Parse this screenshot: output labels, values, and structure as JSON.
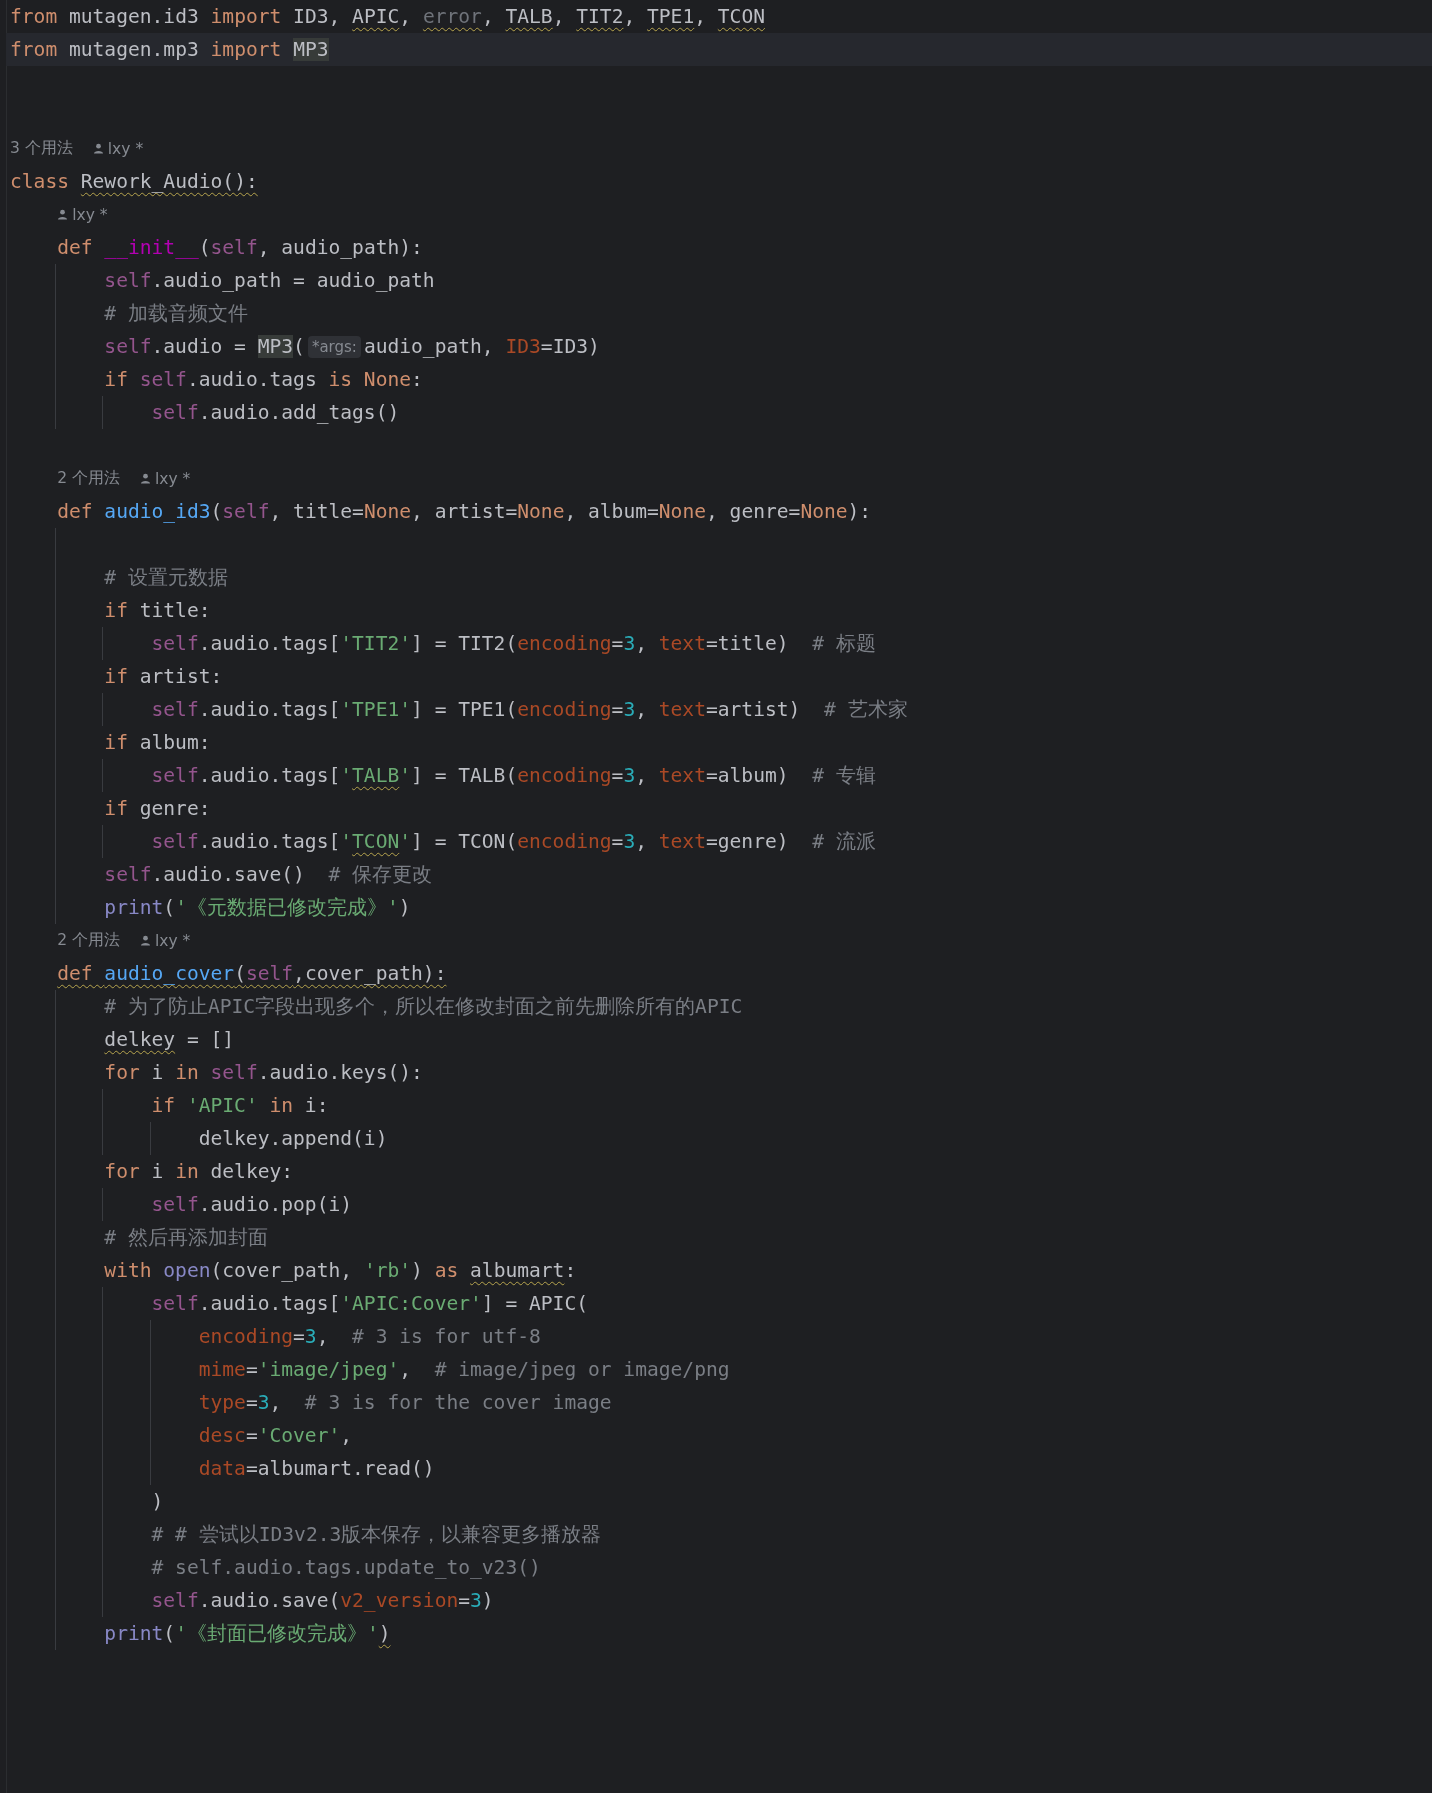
{
  "editor": {
    "lines": [
      {
        "kind": "code",
        "current": false,
        "tokens": [
          {
            "text": "from",
            "kind": "kw"
          },
          {
            "text": " mutagen.id3 ",
            "kind": "plain"
          },
          {
            "text": "import",
            "kind": "kw"
          },
          {
            "text": " ID3, ",
            "kind": "plain"
          },
          {
            "text": "APIC",
            "kind": "plain",
            "squiggle": true
          },
          {
            "text": ", ",
            "kind": "plain"
          },
          {
            "text": "error",
            "kind": "dim",
            "squiggle": true
          },
          {
            "text": ", ",
            "kind": "plain"
          },
          {
            "text": "TALB",
            "kind": "plain",
            "squiggle": true
          },
          {
            "text": ", ",
            "kind": "plain"
          },
          {
            "text": "TIT2",
            "kind": "plain",
            "squiggle": true
          },
          {
            "text": ", ",
            "kind": "plain"
          },
          {
            "text": "TPE1",
            "kind": "plain",
            "squiggle": true
          },
          {
            "text": ", ",
            "kind": "plain"
          },
          {
            "text": "TCON",
            "kind": "plain",
            "squiggle": true
          }
        ]
      },
      {
        "kind": "code",
        "current": true,
        "tokens": [
          {
            "text": "from",
            "kind": "kw"
          },
          {
            "text": " mutagen.mp3 ",
            "kind": "plain"
          },
          {
            "text": "import ",
            "kind": "kw"
          },
          {
            "text": "MP3",
            "kind": "mark"
          }
        ]
      },
      {
        "kind": "blank"
      },
      {
        "kind": "blank"
      },
      {
        "kind": "hint",
        "usages": "3 个用法",
        "author": "lxy *"
      },
      {
        "kind": "code",
        "current": false,
        "tokens": [
          {
            "text": "class ",
            "kind": "kw"
          },
          {
            "text": "Rework_Audio():",
            "kind": "plain",
            "squiggle": true
          }
        ],
        "children": [
          {
            "kind": "hint",
            "author": "lxy *"
          },
          {
            "kind": "code",
            "current": false,
            "tokens": [
              {
                "text": "def ",
                "kind": "kw"
              },
              {
                "text": "__init__",
                "kind": "dunder"
              },
              {
                "text": "(",
                "kind": "plain"
              },
              {
                "text": "self",
                "kind": "self"
              },
              {
                "text": ", audio_path):",
                "kind": "plain"
              }
            ],
            "children": [
              {
                "kind": "code",
                "current": false,
                "tokens": [
                  {
                    "text": "self",
                    "kind": "self"
                  },
                  {
                    "text": ".audio_path = audio_path",
                    "kind": "plain"
                  }
                ]
              },
              {
                "kind": "code",
                "current": false,
                "tokens": [
                  {
                    "text": "# 加载音频文件",
                    "kind": "comment"
                  }
                ]
              },
              {
                "kind": "code",
                "current": false,
                "tokens": [
                  {
                    "text": "self",
                    "kind": "self"
                  },
                  {
                    "text": ".audio = ",
                    "kind": "plain"
                  },
                  {
                    "text": "MP3",
                    "kind": "mark"
                  },
                  {
                    "text": "(",
                    "kind": "plain"
                  },
                  {
                    "text": "*args:",
                    "kind": "inlay"
                  },
                  {
                    "text": "audio_path, ",
                    "kind": "plain"
                  },
                  {
                    "text": "ID3",
                    "kind": "param"
                  },
                  {
                    "text": "=ID3)",
                    "kind": "plain"
                  }
                ]
              },
              {
                "kind": "code",
                "current": false,
                "tokens": [
                  {
                    "text": "if ",
                    "kind": "kw"
                  },
                  {
                    "text": "self",
                    "kind": "self"
                  },
                  {
                    "text": ".audio.tags ",
                    "kind": "plain"
                  },
                  {
                    "text": "is None",
                    "kind": "kw"
                  },
                  {
                    "text": ":",
                    "kind": "plain"
                  }
                ],
                "children": [
                  {
                    "kind": "code",
                    "current": false,
                    "tokens": [
                      {
                        "text": "self",
                        "kind": "self"
                      },
                      {
                        "text": ".audio.add_tags()",
                        "kind": "plain"
                      }
                    ]
                  }
                ]
              }
            ]
          },
          {
            "kind": "blank"
          },
          {
            "kind": "hint",
            "usages": "2 个用法",
            "author": "lxy *"
          },
          {
            "kind": "code",
            "current": false,
            "tokens": [
              {
                "text": "def ",
                "kind": "kw"
              },
              {
                "text": "audio_id3",
                "kind": "func"
              },
              {
                "text": "(",
                "kind": "plain"
              },
              {
                "text": "self",
                "kind": "self"
              },
              {
                "text": ", title=",
                "kind": "plain"
              },
              {
                "text": "None",
                "kind": "kw"
              },
              {
                "text": ", artist=",
                "kind": "plain"
              },
              {
                "text": "None",
                "kind": "kw"
              },
              {
                "text": ", album=",
                "kind": "plain"
              },
              {
                "text": "None",
                "kind": "kw"
              },
              {
                "text": ", genre=",
                "kind": "plain"
              },
              {
                "text": "None",
                "kind": "kw"
              },
              {
                "text": "):",
                "kind": "plain"
              }
            ],
            "children": [
              {
                "kind": "blank"
              },
              {
                "kind": "code",
                "current": false,
                "tokens": [
                  {
                    "text": "# 设置元数据",
                    "kind": "comment"
                  }
                ]
              },
              {
                "kind": "code",
                "current": false,
                "tokens": [
                  {
                    "text": "if",
                    "kind": "kw"
                  },
                  {
                    "text": " title:",
                    "kind": "plain"
                  }
                ],
                "children": [
                  {
                    "kind": "code",
                    "current": false,
                    "tokens": [
                      {
                        "text": "self",
                        "kind": "self"
                      },
                      {
                        "text": ".audio.tags[",
                        "kind": "plain"
                      },
                      {
                        "text": "'TIT2'",
                        "kind": "str"
                      },
                      {
                        "text": "] = TIT2(",
                        "kind": "plain"
                      },
                      {
                        "text": "encoding",
                        "kind": "param"
                      },
                      {
                        "text": "=",
                        "kind": "plain"
                      },
                      {
                        "text": "3",
                        "kind": "num"
                      },
                      {
                        "text": ", ",
                        "kind": "plain"
                      },
                      {
                        "text": "text",
                        "kind": "param"
                      },
                      {
                        "text": "=title)  ",
                        "kind": "plain"
                      },
                      {
                        "text": "# 标题",
                        "kind": "comment"
                      }
                    ]
                  }
                ]
              },
              {
                "kind": "code",
                "current": false,
                "tokens": [
                  {
                    "text": "if",
                    "kind": "kw"
                  },
                  {
                    "text": " artist:",
                    "kind": "plain"
                  }
                ],
                "children": [
                  {
                    "kind": "code",
                    "current": false,
                    "tokens": [
                      {
                        "text": "self",
                        "kind": "self"
                      },
                      {
                        "text": ".audio.tags[",
                        "kind": "plain"
                      },
                      {
                        "text": "'TPE1'",
                        "kind": "str"
                      },
                      {
                        "text": "] = TPE1(",
                        "kind": "plain"
                      },
                      {
                        "text": "encoding",
                        "kind": "param"
                      },
                      {
                        "text": "=",
                        "kind": "plain"
                      },
                      {
                        "text": "3",
                        "kind": "num"
                      },
                      {
                        "text": ", ",
                        "kind": "plain"
                      },
                      {
                        "text": "text",
                        "kind": "param"
                      },
                      {
                        "text": "=artist)  ",
                        "kind": "plain"
                      },
                      {
                        "text": "# 艺术家",
                        "kind": "comment"
                      }
                    ]
                  }
                ]
              },
              {
                "kind": "code",
                "current": false,
                "tokens": [
                  {
                    "text": "if",
                    "kind": "kw"
                  },
                  {
                    "text": " album:",
                    "kind": "plain"
                  }
                ],
                "children": [
                  {
                    "kind": "code",
                    "current": false,
                    "tokens": [
                      {
                        "text": "self",
                        "kind": "self"
                      },
                      {
                        "text": ".audio.tags[",
                        "kind": "plain"
                      },
                      {
                        "text": "'",
                        "kind": "str"
                      },
                      {
                        "text": "TALB",
                        "kind": "str",
                        "squiggle": true
                      },
                      {
                        "text": "'",
                        "kind": "str"
                      },
                      {
                        "text": "] = TALB(",
                        "kind": "plain"
                      },
                      {
                        "text": "encoding",
                        "kind": "param"
                      },
                      {
                        "text": "=",
                        "kind": "plain"
                      },
                      {
                        "text": "3",
                        "kind": "num"
                      },
                      {
                        "text": ", ",
                        "kind": "plain"
                      },
                      {
                        "text": "text",
                        "kind": "param"
                      },
                      {
                        "text": "=album)  ",
                        "kind": "plain"
                      },
                      {
                        "text": "# 专辑",
                        "kind": "comment"
                      }
                    ]
                  }
                ]
              },
              {
                "kind": "code",
                "current": false,
                "tokens": [
                  {
                    "text": "if",
                    "kind": "kw"
                  },
                  {
                    "text": " genre:",
                    "kind": "plain"
                  }
                ],
                "children": [
                  {
                    "kind": "code",
                    "current": false,
                    "tokens": [
                      {
                        "text": "self",
                        "kind": "self"
                      },
                      {
                        "text": ".audio.tags[",
                        "kind": "plain"
                      },
                      {
                        "text": "'",
                        "kind": "str"
                      },
                      {
                        "text": "TCON",
                        "kind": "str",
                        "squiggle": true
                      },
                      {
                        "text": "'",
                        "kind": "str"
                      },
                      {
                        "text": "] = TCON(",
                        "kind": "plain"
                      },
                      {
                        "text": "encoding",
                        "kind": "param"
                      },
                      {
                        "text": "=",
                        "kind": "plain"
                      },
                      {
                        "text": "3",
                        "kind": "num"
                      },
                      {
                        "text": ", ",
                        "kind": "plain"
                      },
                      {
                        "text": "text",
                        "kind": "param"
                      },
                      {
                        "text": "=genre)  ",
                        "kind": "plain"
                      },
                      {
                        "text": "# 流派",
                        "kind": "comment"
                      }
                    ]
                  }
                ]
              },
              {
                "kind": "code",
                "current": false,
                "tokens": [
                  {
                    "text": "self",
                    "kind": "self"
                  },
                  {
                    "text": ".audio.save()  ",
                    "kind": "plain"
                  },
                  {
                    "text": "# 保存更改",
                    "kind": "comment"
                  }
                ]
              },
              {
                "kind": "code",
                "current": false,
                "tokens": [
                  {
                    "text": "print",
                    "kind": "builtin"
                  },
                  {
                    "text": "(",
                    "kind": "plain"
                  },
                  {
                    "text": "'《元数据已修改完成》'",
                    "kind": "str"
                  },
                  {
                    "text": ")",
                    "kind": "plain"
                  }
                ]
              }
            ]
          },
          {
            "kind": "hint",
            "usages": "2 个用法",
            "author": "lxy *"
          },
          {
            "kind": "code",
            "current": false,
            "tokens": [
              {
                "text": "def ",
                "kind": "kw",
                "squiggle": true
              },
              {
                "text": "audio_cover",
                "kind": "func",
                "squiggle": true
              },
              {
                "text": "(",
                "kind": "plain",
                "squiggle": true
              },
              {
                "text": "self",
                "kind": "self",
                "squiggle": true
              },
              {
                "text": ",cover_path):",
                "kind": "plain",
                "squiggle": true
              }
            ],
            "children": [
              {
                "kind": "code",
                "current": false,
                "tokens": [
                  {
                    "text": "# 为了防止APIC字段出现多个，所以在修改封面之前先删除所有的APIC",
                    "kind": "comment"
                  }
                ]
              },
              {
                "kind": "code",
                "current": false,
                "tokens": [
                  {
                    "text": "delkey",
                    "kind": "plain",
                    "squiggle": true
                  },
                  {
                    "text": " = []",
                    "kind": "plain"
                  }
                ]
              },
              {
                "kind": "code",
                "current": false,
                "tokens": [
                  {
                    "text": "for",
                    "kind": "kw"
                  },
                  {
                    "text": " i ",
                    "kind": "plain"
                  },
                  {
                    "text": "in ",
                    "kind": "kw"
                  },
                  {
                    "text": "self",
                    "kind": "self"
                  },
                  {
                    "text": ".audio.keys():",
                    "kind": "plain"
                  }
                ],
                "children": [
                  {
                    "kind": "code",
                    "current": false,
                    "tokens": [
                      {
                        "text": "if ",
                        "kind": "kw"
                      },
                      {
                        "text": "'APIC' ",
                        "kind": "str"
                      },
                      {
                        "text": "in",
                        "kind": "kw"
                      },
                      {
                        "text": " i:",
                        "kind": "plain"
                      }
                    ],
                    "children": [
                      {
                        "kind": "code",
                        "current": false,
                        "tokens": [
                          {
                            "text": "delkey.append(i)",
                            "kind": "plain"
                          }
                        ]
                      }
                    ]
                  }
                ]
              },
              {
                "kind": "code",
                "current": false,
                "tokens": [
                  {
                    "text": "for",
                    "kind": "kw"
                  },
                  {
                    "text": " i ",
                    "kind": "plain"
                  },
                  {
                    "text": "in",
                    "kind": "kw"
                  },
                  {
                    "text": " delkey:",
                    "kind": "plain"
                  }
                ],
                "children": [
                  {
                    "kind": "code",
                    "current": false,
                    "tokens": [
                      {
                        "text": "self",
                        "kind": "self"
                      },
                      {
                        "text": ".audio.pop(i)",
                        "kind": "plain"
                      }
                    ]
                  }
                ]
              },
              {
                "kind": "code",
                "current": false,
                "tokens": [
                  {
                    "text": "# 然后再添加封面",
                    "kind": "comment"
                  }
                ]
              },
              {
                "kind": "code",
                "current": false,
                "tokens": [
                  {
                    "text": "with ",
                    "kind": "kw"
                  },
                  {
                    "text": "open",
                    "kind": "builtin"
                  },
                  {
                    "text": "(cover_path, ",
                    "kind": "plain"
                  },
                  {
                    "text": "'rb'",
                    "kind": "str"
                  },
                  {
                    "text": ") ",
                    "kind": "plain"
                  },
                  {
                    "text": "as ",
                    "kind": "kw"
                  },
                  {
                    "text": "albumart",
                    "kind": "plain",
                    "squiggle": true
                  },
                  {
                    "text": ":",
                    "kind": "plain"
                  }
                ],
                "children": [
                  {
                    "kind": "code",
                    "current": false,
                    "tokens": [
                      {
                        "text": "self",
                        "kind": "self"
                      },
                      {
                        "text": ".audio.tags[",
                        "kind": "plain"
                      },
                      {
                        "text": "'APIC:Cover'",
                        "kind": "str"
                      },
                      {
                        "text": "] = APIC(",
                        "kind": "plain"
                      }
                    ],
                    "children": [
                      {
                        "kind": "code",
                        "current": false,
                        "tokens": [
                          {
                            "text": "encoding",
                            "kind": "param"
                          },
                          {
                            "text": "=",
                            "kind": "plain"
                          },
                          {
                            "text": "3",
                            "kind": "num"
                          },
                          {
                            "text": ",  ",
                            "kind": "plain"
                          },
                          {
                            "text": "# 3 is for utf-8",
                            "kind": "comment"
                          }
                        ]
                      },
                      {
                        "kind": "code",
                        "current": false,
                        "tokens": [
                          {
                            "text": "mime",
                            "kind": "param"
                          },
                          {
                            "text": "=",
                            "kind": "plain"
                          },
                          {
                            "text": "'image/jpeg'",
                            "kind": "str"
                          },
                          {
                            "text": ",  ",
                            "kind": "plain"
                          },
                          {
                            "text": "# image/jpeg or image/png",
                            "kind": "comment"
                          }
                        ]
                      },
                      {
                        "kind": "code",
                        "current": false,
                        "tokens": [
                          {
                            "text": "type",
                            "kind": "param"
                          },
                          {
                            "text": "=",
                            "kind": "plain"
                          },
                          {
                            "text": "3",
                            "kind": "num"
                          },
                          {
                            "text": ",  ",
                            "kind": "plain"
                          },
                          {
                            "text": "# 3 is for the cover image",
                            "kind": "comment"
                          }
                        ]
                      },
                      {
                        "kind": "code",
                        "current": false,
                        "tokens": [
                          {
                            "text": "desc",
                            "kind": "param"
                          },
                          {
                            "text": "=",
                            "kind": "plain"
                          },
                          {
                            "text": "'Cover'",
                            "kind": "str"
                          },
                          {
                            "text": ",",
                            "kind": "plain"
                          }
                        ]
                      },
                      {
                        "kind": "code",
                        "current": false,
                        "tokens": [
                          {
                            "text": "data",
                            "kind": "param"
                          },
                          {
                            "text": "=albumart.read()",
                            "kind": "plain"
                          }
                        ]
                      }
                    ]
                  },
                  {
                    "kind": "code",
                    "current": false,
                    "tokens": [
                      {
                        "text": ")",
                        "kind": "plain"
                      }
                    ]
                  },
                  {
                    "kind": "code",
                    "current": false,
                    "tokens": [
                      {
                        "text": "# # 尝试以ID3v2.3版本保存，以兼容更多播放器",
                        "kind": "comment"
                      }
                    ]
                  },
                  {
                    "kind": "code",
                    "current": false,
                    "tokens": [
                      {
                        "text": "# self.audio.tags.update_to_v23()",
                        "kind": "comment"
                      }
                    ]
                  },
                  {
                    "kind": "code",
                    "current": false,
                    "tokens": [
                      {
                        "text": "self",
                        "kind": "self"
                      },
                      {
                        "text": ".audio.save(",
                        "kind": "plain"
                      },
                      {
                        "text": "v2_version",
                        "kind": "param"
                      },
                      {
                        "text": "=",
                        "kind": "plain"
                      },
                      {
                        "text": "3",
                        "kind": "num"
                      },
                      {
                        "text": ")",
                        "kind": "plain"
                      }
                    ]
                  }
                ]
              },
              {
                "kind": "code",
                "current": false,
                "tokens": [
                  {
                    "text": "print",
                    "kind": "builtin"
                  },
                  {
                    "text": "(",
                    "kind": "plain"
                  },
                  {
                    "text": "'《封面已修改完成》'",
                    "kind": "str"
                  },
                  {
                    "text": ")",
                    "kind": "plain",
                    "squiggle": true
                  }
                ]
              }
            ]
          }
        ]
      }
    ]
  }
}
